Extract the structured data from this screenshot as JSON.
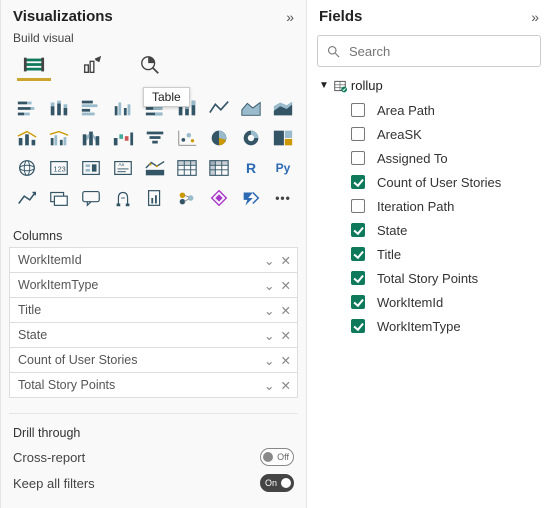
{
  "viz": {
    "title": "Visualizations",
    "subhead": "Build visual",
    "tabs": {
      "build": "build-visual",
      "format": "format-visual",
      "analytics": "analytics"
    },
    "tooltip": {
      "text": "Table"
    },
    "columns_label": "Columns",
    "columns": [
      {
        "label": "WorkItemId"
      },
      {
        "label": "WorkItemType"
      },
      {
        "label": "Title"
      },
      {
        "label": "State"
      },
      {
        "label": "Count of User Stories"
      },
      {
        "label": "Total Story Points"
      }
    ],
    "drill": {
      "heading": "Drill through",
      "cross_report": {
        "label": "Cross-report",
        "state": "Off",
        "on": false
      },
      "keep_filters": {
        "label": "Keep all filters",
        "state": "On",
        "on": true
      }
    },
    "gallery": [
      [
        "stacked-bar",
        "stacked-column",
        "clustered-bar",
        "clustered-column",
        "100-stacked-bar",
        "100-stacked-column",
        "line",
        "area",
        "stacked-area"
      ],
      [
        "line-stacked-column",
        "line-clustered-column",
        "ribbon",
        "waterfall",
        "funnel",
        "scatter",
        "pie",
        "donut",
        "treemap"
      ],
      [
        "map",
        "filled-map",
        "azure-map",
        "gauge",
        "card",
        "multi-row-card",
        "kpi",
        "slicer",
        "table"
      ],
      [
        "matrix",
        "r-visual",
        "py-visual",
        "key-influencers",
        "decomposition-tree",
        "qna",
        "smart-narrative",
        "paginated",
        "arc"
      ],
      [
        "more"
      ]
    ],
    "r_label": "R",
    "py_label": "Py"
  },
  "fields": {
    "title": "Fields",
    "search_placeholder": "Search",
    "group": {
      "name": "rollup",
      "expanded": true
    },
    "items": [
      {
        "label": "Area Path",
        "checked": false
      },
      {
        "label": "AreaSK",
        "checked": false
      },
      {
        "label": "Assigned To",
        "checked": false
      },
      {
        "label": "Count of User Stories",
        "checked": true
      },
      {
        "label": "Iteration Path",
        "checked": false
      },
      {
        "label": "State",
        "checked": true
      },
      {
        "label": "Title",
        "checked": true
      },
      {
        "label": "Total Story Points",
        "checked": true
      },
      {
        "label": "WorkItemId",
        "checked": true
      },
      {
        "label": "WorkItemType",
        "checked": true
      }
    ]
  }
}
